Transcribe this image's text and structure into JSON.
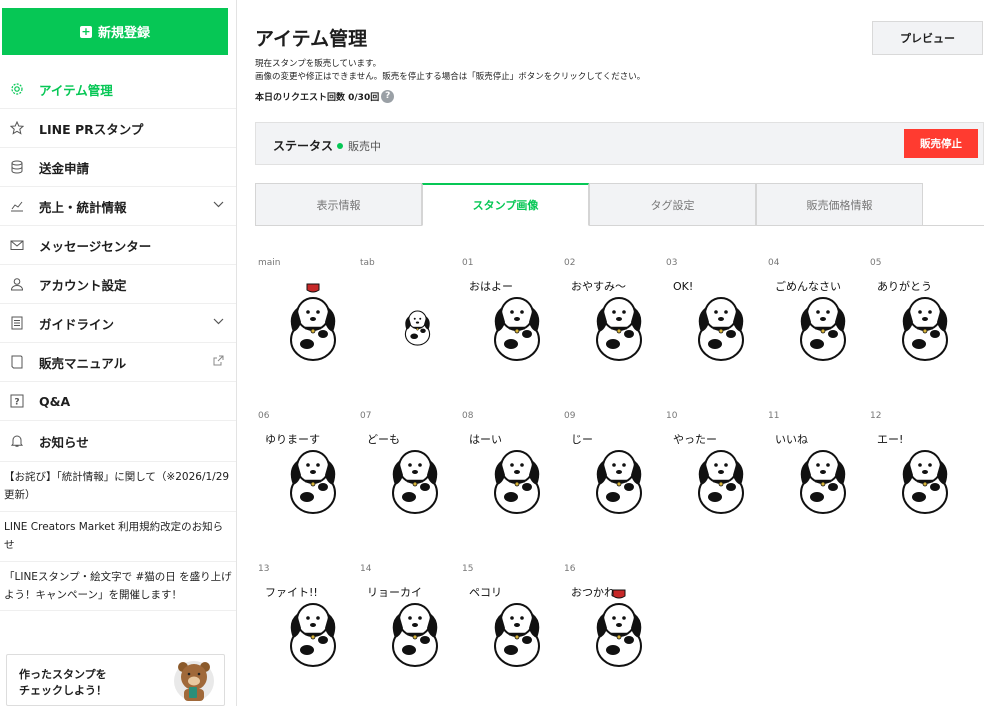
{
  "sidebar": {
    "new_button": "新規登録",
    "items": [
      {
        "label": "アイテム管理",
        "icon": "gear-icon"
      },
      {
        "label": "LINE PRスタンプ",
        "icon": "star-icon"
      },
      {
        "label": "送金申請",
        "icon": "database-icon"
      },
      {
        "label": "売上・統計情報",
        "icon": "chart-icon"
      },
      {
        "label": "メッセージセンター",
        "icon": "mail-icon"
      },
      {
        "label": "アカウント設定",
        "icon": "user-icon"
      },
      {
        "label": "ガイドライン",
        "icon": "document-icon"
      },
      {
        "label": "販売マニュアル",
        "icon": "book-icon"
      },
      {
        "label": "Q&A",
        "icon": "question-icon"
      }
    ],
    "notice_label": "お知らせ",
    "news": [
      "【お詫び】「統計情報」に関して（※2026/1/29 更新）",
      "LINE Creators Market 利用規約改定のお知らせ",
      "「LINEスタンプ・絵文字で #猫の日 を盛り上げよう！キャンペーン」を開催します！"
    ],
    "promo_line1": "作ったスタンプを",
    "promo_line2": "チェックしよう！"
  },
  "main": {
    "title": "アイテム管理",
    "preview_button": "プレビュー",
    "desc_line1": "現在スタンプを販売しています。",
    "desc_line2": "画像の変更や修正はできません。販売を停止する場合は「販売停止」ボタンをクリックしてください。",
    "request_count": "本日のリクエスト回数 0/30回",
    "status_label": "ステータス",
    "status_value": "販売中",
    "stop_button": "販売停止",
    "tabs": [
      "表示情報",
      "スタンプ画像",
      "タグ設定",
      "販売価格情報"
    ],
    "active_tab": "スタンプ画像"
  },
  "stamps": [
    {
      "id": "main",
      "text": ""
    },
    {
      "id": "tab",
      "text": ""
    },
    {
      "id": "01",
      "text": "おはよー"
    },
    {
      "id": "02",
      "text": "おやすみ〜"
    },
    {
      "id": "03",
      "text": "OK!"
    },
    {
      "id": "04",
      "text": "ごめんなさい"
    },
    {
      "id": "05",
      "text": "ありがとう"
    },
    {
      "id": "06",
      "text": "ゆりまーす"
    },
    {
      "id": "07",
      "text": "どーも"
    },
    {
      "id": "08",
      "text": "はーい"
    },
    {
      "id": "09",
      "text": "じー"
    },
    {
      "id": "10",
      "text": "やったー"
    },
    {
      "id": "11",
      "text": "いいね"
    },
    {
      "id": "12",
      "text": "エー!"
    },
    {
      "id": "13",
      "text": "ファイト!!"
    },
    {
      "id": "14",
      "text": "リョーカイ"
    },
    {
      "id": "15",
      "text": "ペコリ"
    },
    {
      "id": "16",
      "text": "おつかれー"
    }
  ],
  "colors": {
    "accent": "#06c755",
    "danger": "#ff3b30"
  }
}
